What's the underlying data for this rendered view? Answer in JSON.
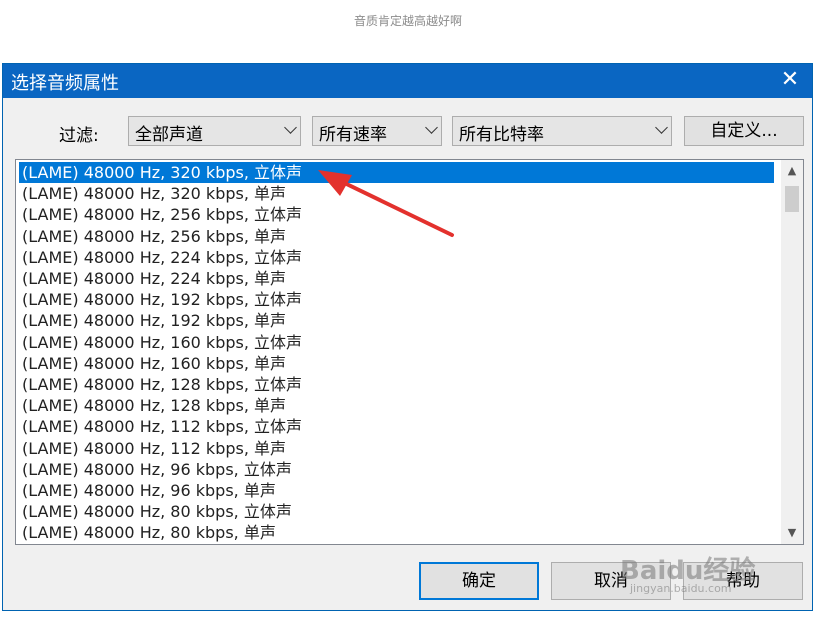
{
  "caption": "音质肯定越高越好啊",
  "dialog": {
    "title": "选择音频属性",
    "close_glyph": "✕",
    "filter_label": "过滤:",
    "channel_filter": "全部声道",
    "rate_filter": "所有速率",
    "bitrate_filter": "所有比特率",
    "custom_button": "自定义...",
    "items": [
      "(LAME) 48000 Hz, 320 kbps, 立体声",
      "(LAME) 48000 Hz, 320 kbps, 单声",
      "(LAME) 48000 Hz, 256 kbps, 立体声",
      "(LAME) 48000 Hz, 256 kbps, 单声",
      "(LAME) 48000 Hz, 224 kbps, 立体声",
      "(LAME) 48000 Hz, 224 kbps, 单声",
      "(LAME) 48000 Hz, 192 kbps, 立体声",
      "(LAME) 48000 Hz, 192 kbps, 单声",
      "(LAME) 48000 Hz, 160 kbps, 立体声",
      "(LAME) 48000 Hz, 160 kbps, 单声",
      "(LAME) 48000 Hz, 128 kbps, 立体声",
      "(LAME) 48000 Hz, 128 kbps, 单声",
      "(LAME) 48000 Hz, 112 kbps, 立体声",
      "(LAME) 48000 Hz, 112 kbps, 单声",
      "(LAME) 48000 Hz, 96 kbps, 立体声",
      "(LAME) 48000 Hz, 96 kbps, 单声",
      "(LAME) 48000 Hz, 80 kbps, 立体声",
      "(LAME) 48000 Hz, 80 kbps, 单声"
    ],
    "ok_button": "确定",
    "cancel_button": "取消",
    "help_button": "帮助"
  },
  "watermark": {
    "brand": "Baidu经验",
    "url": "jingyan.baidu.com"
  },
  "colors": {
    "titlebar": "#0a66c2",
    "selection": "#0078d7",
    "arrow": "#e3312d"
  }
}
